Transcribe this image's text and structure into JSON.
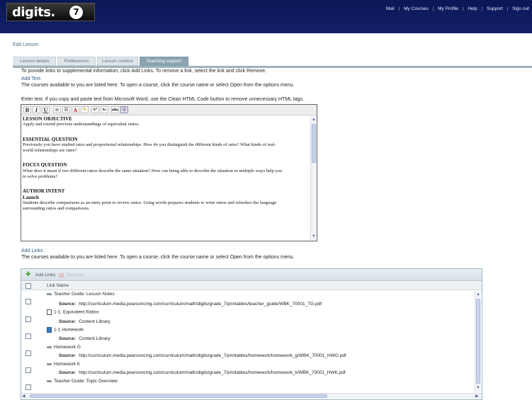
{
  "brand": {
    "logo_text": "digits.",
    "grade_badge": "7"
  },
  "topnav": {
    "items": [
      "Mail",
      "My Courses",
      "My Profile",
      "Help",
      "Support",
      "Sign out"
    ],
    "separator": "|"
  },
  "page": {
    "title": "Edit Lesson"
  },
  "tabs": [
    {
      "label": "Lesson details",
      "active": false
    },
    {
      "label": "Preferences",
      "active": false
    },
    {
      "label": "Lesson content",
      "active": false
    },
    {
      "label": "Teaching support",
      "active": true
    }
  ],
  "intro": "To provide links to supplemental information, click Add Links. To remove a link, select the link and click Remove.",
  "add_text": {
    "heading": "Add Text",
    "help": "The courses available to you are listed here. To open a course, click the course name or select Open from the options menu.",
    "instruction": "Enter text. If you copy and paste text from Microsoft Word, use the Clean HTML Code button to remove unnecessary HTML tags."
  },
  "editor_toolbar": {
    "buttons": [
      {
        "name": "bold-button",
        "glyph": "B"
      },
      {
        "name": "italic-button",
        "glyph": "I"
      },
      {
        "name": "underline-button",
        "glyph": "U"
      },
      {
        "name": "ordered-list-button",
        "glyph": "≡"
      },
      {
        "name": "unordered-list-button",
        "glyph": "☰"
      },
      {
        "name": "text-color-button",
        "glyph": "A"
      },
      {
        "name": "highlight-button",
        "glyph": "✎"
      },
      {
        "name": "superscript-button",
        "glyph": "x²"
      },
      {
        "name": "subscript-button",
        "glyph": "x₂"
      },
      {
        "name": "strikethrough-button",
        "glyph": "abc"
      },
      {
        "name": "clean-html-button",
        "glyph": "⚙"
      }
    ]
  },
  "editor_content": {
    "objective_heading": "LESSON OBJECTIVE",
    "objective_text": "Apply and extend previous understandings of equivalent ratios.",
    "essential_heading": "ESSENTIAL QUESTION",
    "essential_text_1": "Previously you have studied rates and proportional relationships. How do you distinguish the different kinds of rates? What kinds of real-",
    "essential_text_2": "world relationships are rates?",
    "focus_heading": "FOCUS QUESTION",
    "focus_text_1": "What does it mean if two different ratios describe the same situation? How can being able to describe the situation in multiple ways help you",
    "focus_text_2": "to solve problems?",
    "intent_heading": "AUTHOR INTENT",
    "launch_heading": "Launch",
    "launch_text_1": "Students describe comparisons as an entry point to review ratios. Using words prepares students to write ratios and refreshes the language",
    "launch_text_2": "surrounding ratios and comparisons."
  },
  "add_links": {
    "heading": "Add Links",
    "help": "The courses available to you are listed here. To open a course, click the course name or select Open from the options menu.",
    "add_label": "Add Links",
    "remove_label": "Remove",
    "column_header": "Link Name",
    "source_label": "Source:",
    "rows": [
      {
        "icon": "link",
        "title": "Teacher Guide: Lesson Notes",
        "source": "http://curriculum.media.pearsoncmg.com/curriculum/math/digits/grade_7/printables/teacher_guide/WBK_70001_TG.pdf"
      },
      {
        "icon": "doc",
        "title": "1-1: Equivalent Ratios",
        "source": "Content Library"
      },
      {
        "icon": "hw",
        "title": "1-1 Homework",
        "source": "Content Library"
      },
      {
        "icon": "link",
        "title": "Homework G",
        "source": "http://curriculum.media.pearsoncmg.com/curriculum/math/digits/grade_7/printables/homework/homework_g/WBK_70001_HWG.pdf"
      },
      {
        "icon": "link",
        "title": "Homework K",
        "source": "http://curriculum.media.pearsoncmg.com/curriculum/math/digits/grade_7/printables/homework/homework_k/WBK_70001_HWK.pdf"
      },
      {
        "icon": "link",
        "title": "Teacher Guide: Topic Overview",
        "source": ""
      }
    ]
  }
}
